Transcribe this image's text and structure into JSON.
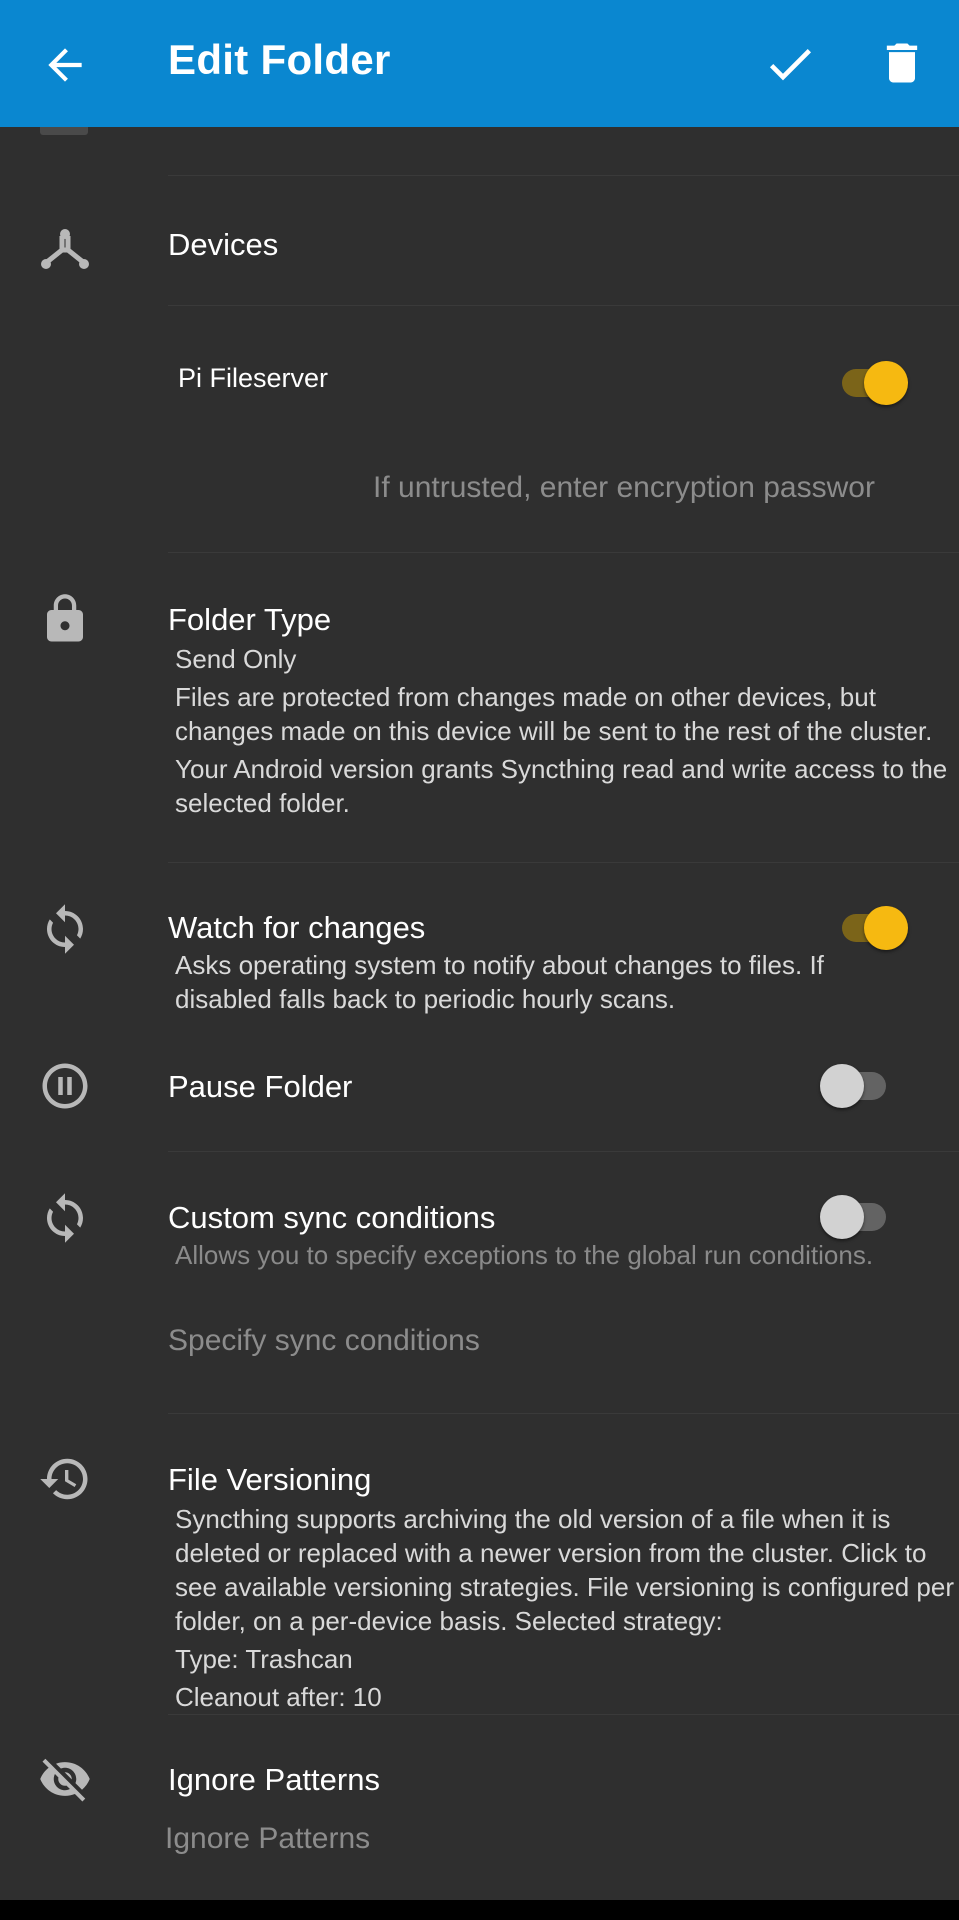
{
  "app_bar": {
    "title": "Edit Folder",
    "back_icon": "arrow-left-icon",
    "confirm_icon": "check-icon",
    "delete_icon": "trash-icon",
    "background_color": "#0a87d0"
  },
  "devices": {
    "label": "Devices",
    "icon": "devices-icon",
    "items": [
      {
        "name": "Pi Fileserver",
        "enabled": true
      }
    ],
    "password_placeholder": "If untrusted, enter encryption passwor"
  },
  "folder_type": {
    "label": "Folder Type",
    "value": "Send Only",
    "description": "Files are protected from changes made on other devices, but changes made on this device will be sent to the rest of the cluster.",
    "note": "Your Android version grants Syncthing read and write access to the selected folder."
  },
  "watch_for_changes": {
    "label": "Watch for changes",
    "description": "Asks operating system to notify about changes to files. If disabled falls back to periodic hourly scans.",
    "enabled": true
  },
  "pause_folder": {
    "label": "Pause Folder",
    "enabled": false
  },
  "custom_sync": {
    "label": "Custom sync conditions",
    "description": "Allows you to specify exceptions to the global run conditions.",
    "enabled": false,
    "link_label": "Specify sync conditions"
  },
  "file_versioning": {
    "label": "File Versioning",
    "description": "Syncthing supports archiving the old version of a file when it is deleted or replaced with a newer version from the cluster. Click to see available versioning strategies. File versioning is configured per folder, on a per-device basis. Selected strategy:",
    "type": "Type: Trashcan",
    "cleanout": "Cleanout after: 10"
  },
  "ignore_patterns": {
    "label": "Ignore Patterns",
    "link_label": "Ignore Patterns"
  },
  "colors": {
    "accent": "#f6b911",
    "background": "#2f2f2f"
  }
}
